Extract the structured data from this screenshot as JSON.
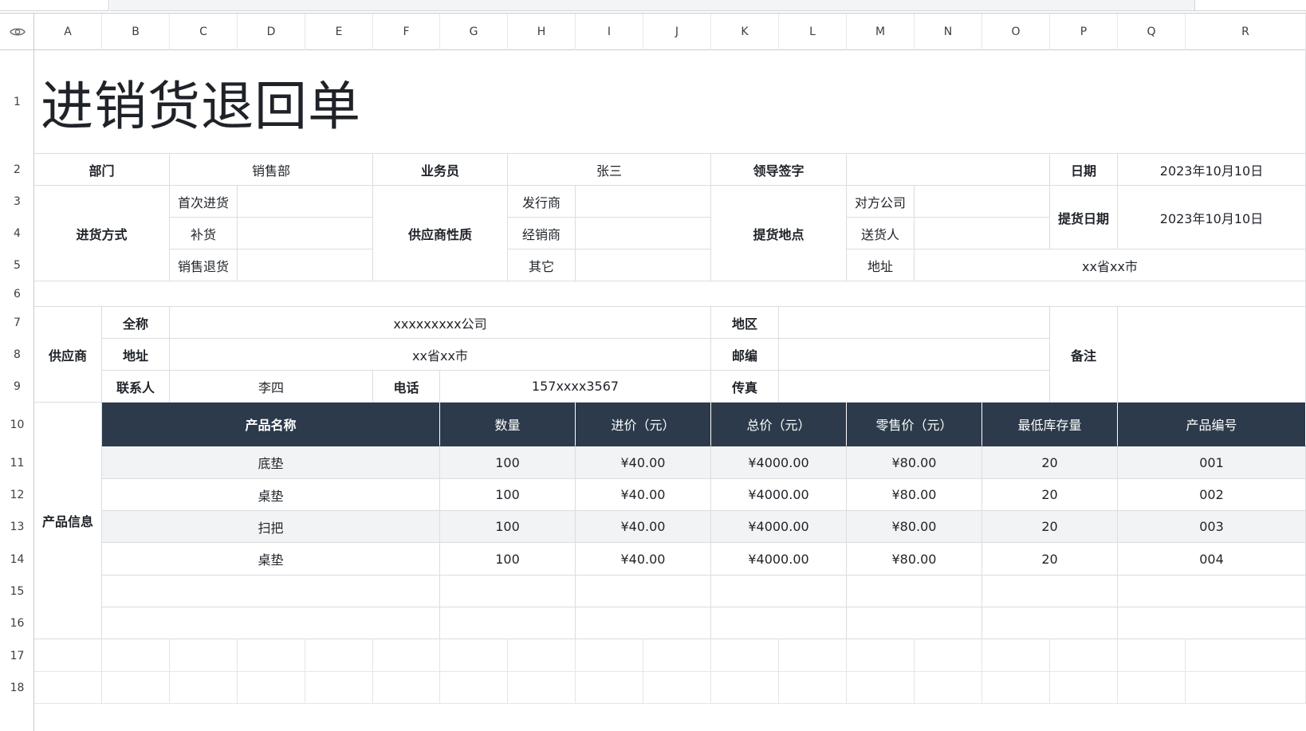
{
  "columns": [
    "A",
    "B",
    "C",
    "D",
    "E",
    "F",
    "G",
    "H",
    "I",
    "J",
    "K",
    "L",
    "M",
    "N",
    "O",
    "P",
    "Q",
    "R"
  ],
  "rows": [
    "1",
    "2",
    "3",
    "4",
    "5",
    "6",
    "7",
    "8",
    "9",
    "10",
    "11",
    "12",
    "13",
    "14",
    "15",
    "16",
    "17",
    "18"
  ],
  "icons": {
    "visibility": "eye-icon"
  },
  "form": {
    "title": "进销货退回单",
    "dept_label": "部门",
    "dept_value": "销售部",
    "salesman_label": "业务员",
    "salesman_value": "张三",
    "leader_sign_label": "领导签字",
    "leader_sign_value": "",
    "date_label": "日期",
    "date_value": "2023年10月10日",
    "purchase_method_label": "进货方式",
    "first_purchase": "首次进货",
    "restock": "补货",
    "sales_return": "销售退货",
    "supplier_nature_label": "供应商性质",
    "issuer": "发行商",
    "distributor": "经销商",
    "other": "其它",
    "pickup_place_label": "提货地点",
    "counterparty": "对方公司",
    "deliverer": "送货人",
    "address_label": "地址",
    "address_value": "xx省xx市",
    "pickup_date_label": "提货日期",
    "pickup_date_value": "2023年10月10日"
  },
  "supplier": {
    "section_label": "供应商",
    "fullname_label": "全称",
    "fullname_value": "xxxxxxxxx公司",
    "address_label": "地址",
    "address_value": "xx省xx市",
    "contact_label": "联系人",
    "contact_value": "李四",
    "phone_label": "电话",
    "phone_value": "157xxxx3567",
    "region_label": "地区",
    "zip_label": "邮编",
    "fax_label": "传真",
    "remark_label": "备注"
  },
  "products": {
    "section_label": "产品信息",
    "headers": [
      "产品名称",
      "数量",
      "进价（元）",
      "总价（元）",
      "零售价（元）",
      "最低库存量",
      "产品编号"
    ],
    "rows": [
      [
        "底垫",
        "100",
        "¥40.00",
        "¥4000.00",
        "¥80.00",
        "20",
        "001"
      ],
      [
        "桌垫",
        "100",
        "¥40.00",
        "¥4000.00",
        "¥80.00",
        "20",
        "002"
      ],
      [
        "扫把",
        "100",
        "¥40.00",
        "¥4000.00",
        "¥80.00",
        "20",
        "003"
      ],
      [
        "桌垫",
        "100",
        "¥40.00",
        "¥4000.00",
        "¥80.00",
        "20",
        "004"
      ]
    ]
  }
}
